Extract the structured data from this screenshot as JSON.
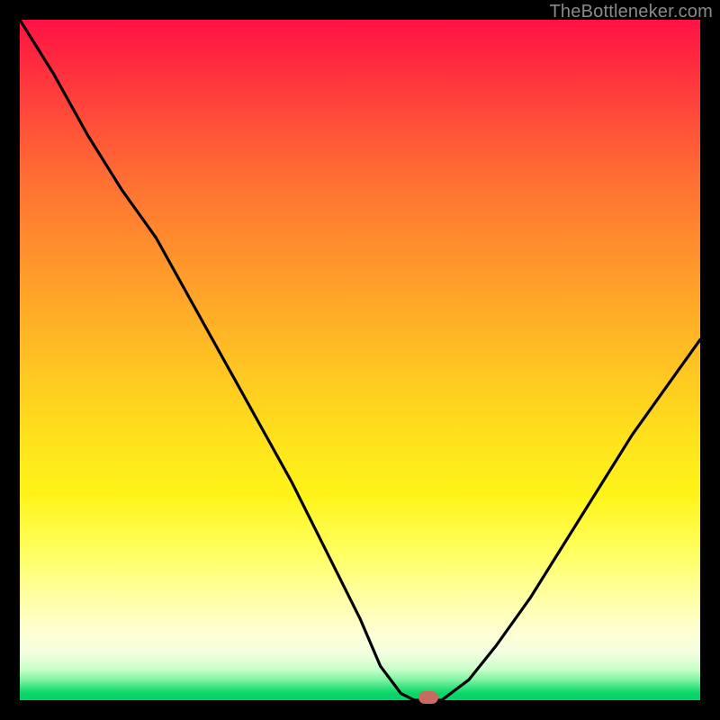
{
  "watermark": "TheBottleneker.com",
  "colors": {
    "frame": "#000000",
    "curve": "#000000",
    "marker_fill": "#c86a5f"
  },
  "chart_data": {
    "type": "line",
    "title": "",
    "xlabel": "",
    "ylabel": "",
    "xlim": [
      0,
      100
    ],
    "ylim": [
      0,
      100
    ],
    "series": [
      {
        "name": "bottleneck-curve",
        "x": [
          0,
          5,
          10,
          15,
          20,
          25,
          30,
          35,
          40,
          45,
          50,
          53,
          56,
          58,
          62,
          66,
          70,
          75,
          80,
          85,
          90,
          95,
          100
        ],
        "y": [
          100,
          92,
          83,
          75,
          68,
          59,
          50,
          41,
          32,
          22,
          12,
          5,
          1,
          0,
          0,
          3,
          8,
          15,
          23,
          31,
          39,
          46,
          53
        ]
      }
    ],
    "marker": {
      "x": 60,
      "y": 0
    },
    "annotations": []
  }
}
